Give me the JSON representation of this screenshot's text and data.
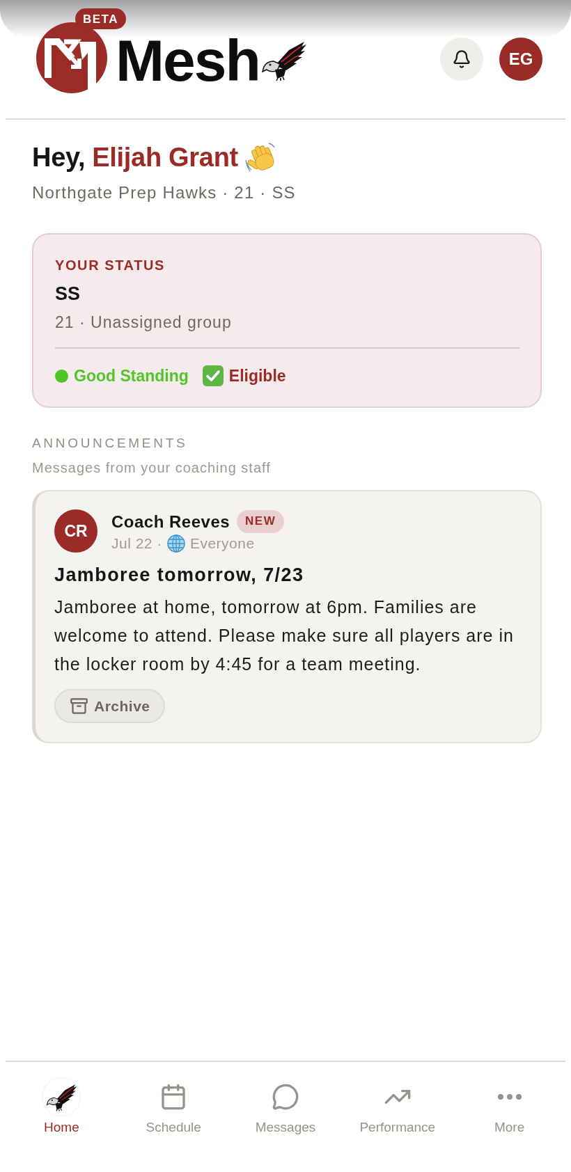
{
  "header": {
    "logo": {
      "badge": "BETA",
      "wordmark": "Mesh"
    },
    "avatar": {
      "initials": "EG"
    }
  },
  "greeting": {
    "prefix": "Hey,",
    "name": "Elijah Grant",
    "subtitle": "Northgate Prep Hawks · 21 · SS"
  },
  "status_card": {
    "label": "YOUR STATUS",
    "position": "SS",
    "detail": "21 · Unassigned group",
    "badges": [
      {
        "kind": "dot",
        "text": "Good Standing",
        "color": "#4fc626"
      },
      {
        "kind": "check",
        "text": "Eligible",
        "color": "#9b2b26"
      }
    ]
  },
  "announcements": {
    "title": "ANNOUNCEMENTS",
    "subtitle": "Messages from your coaching staff",
    "items": [
      {
        "author_initials": "CR",
        "author": "Coach Reeves",
        "badge": "NEW",
        "date": "Jul 22 ·",
        "audience": "Everyone",
        "title": "Jamboree tomorrow, 7/23",
        "body": "Jamboree at home, tomorrow at 6pm. Families are welcome to attend. Please make sure all players are in the locker room by 4:45 for a team meeting.",
        "action": "Archive"
      }
    ]
  },
  "nav": {
    "items": [
      {
        "label": "Home",
        "selected": true
      },
      {
        "label": "Schedule",
        "selected": false
      },
      {
        "label": "Messages",
        "selected": false
      },
      {
        "label": "Performance",
        "selected": false
      },
      {
        "label": "More",
        "selected": false
      }
    ]
  }
}
